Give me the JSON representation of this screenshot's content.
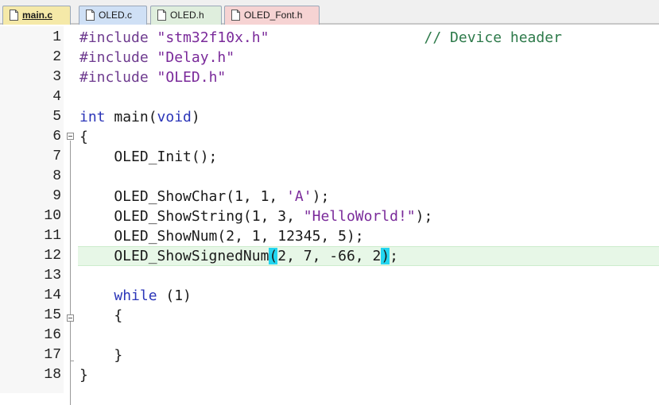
{
  "tabs": [
    {
      "label": "main.c",
      "active": true,
      "color": "#f5e9a8"
    },
    {
      "label": "OLED.c",
      "active": false,
      "color": "#cfe0f5"
    },
    {
      "label": "OLED.h",
      "active": false,
      "color": "#dfeedd"
    },
    {
      "label": "OLED_Font.h",
      "active": false,
      "color": "#f6d3d3"
    }
  ],
  "editor": {
    "highlight_color": "#e7f7e7",
    "brace_match_color": "#23d6f0",
    "lines": [
      {
        "n": "1",
        "tokens": [
          {
            "t": "pp",
            "v": "#include "
          },
          {
            "t": "str",
            "v": "\"stm32f10x.h\""
          },
          {
            "t": "plain",
            "v": "                  "
          },
          {
            "t": "cmt",
            "v": "// Device header"
          }
        ]
      },
      {
        "n": "2",
        "tokens": [
          {
            "t": "pp",
            "v": "#include "
          },
          {
            "t": "str",
            "v": "\"Delay.h\""
          }
        ]
      },
      {
        "n": "3",
        "tokens": [
          {
            "t": "pp",
            "v": "#include "
          },
          {
            "t": "str",
            "v": "\"OLED.h\""
          }
        ]
      },
      {
        "n": "4",
        "tokens": []
      },
      {
        "n": "5",
        "tokens": [
          {
            "t": "kw",
            "v": "int"
          },
          {
            "t": "plain",
            "v": " main("
          },
          {
            "t": "kw",
            "v": "void"
          },
          {
            "t": "plain",
            "v": ")"
          }
        ]
      },
      {
        "n": "6",
        "tokens": [
          {
            "t": "plain",
            "v": "{"
          }
        ]
      },
      {
        "n": "7",
        "tokens": [
          {
            "t": "plain",
            "v": "    OLED_Init();"
          }
        ]
      },
      {
        "n": "8",
        "tokens": []
      },
      {
        "n": "9",
        "tokens": [
          {
            "t": "plain",
            "v": "    OLED_ShowChar(1, 1, "
          },
          {
            "t": "str",
            "v": "'A'"
          },
          {
            "t": "plain",
            "v": ");"
          }
        ]
      },
      {
        "n": "10",
        "tokens": [
          {
            "t": "plain",
            "v": "    OLED_ShowString(1, 3, "
          },
          {
            "t": "str",
            "v": "\"HelloWorld!\""
          },
          {
            "t": "plain",
            "v": ");"
          }
        ]
      },
      {
        "n": "11",
        "tokens": [
          {
            "t": "plain",
            "v": "    OLED_ShowNum(2, 1, 12345, 5);"
          }
        ]
      },
      {
        "n": "12",
        "tokens": [
          {
            "t": "plain",
            "v": "    OLED_ShowSignedNum"
          },
          {
            "t": "brace",
            "v": "("
          },
          {
            "t": "plain",
            "v": "2, 7, -66, 2"
          },
          {
            "t": "brace",
            "v": ")"
          },
          {
            "t": "plain",
            "v": ";"
          }
        ],
        "highlighted": true
      },
      {
        "n": "13",
        "tokens": []
      },
      {
        "n": "14",
        "tokens": [
          {
            "t": "plain",
            "v": "    "
          },
          {
            "t": "kw",
            "v": "while"
          },
          {
            "t": "plain",
            "v": " (1)"
          }
        ]
      },
      {
        "n": "15",
        "tokens": [
          {
            "t": "plain",
            "v": "    {"
          }
        ]
      },
      {
        "n": "16",
        "tokens": []
      },
      {
        "n": "17",
        "tokens": [
          {
            "t": "plain",
            "v": "    }"
          }
        ]
      },
      {
        "n": "18",
        "tokens": [
          {
            "t": "plain",
            "v": "}"
          }
        ]
      }
    ]
  }
}
